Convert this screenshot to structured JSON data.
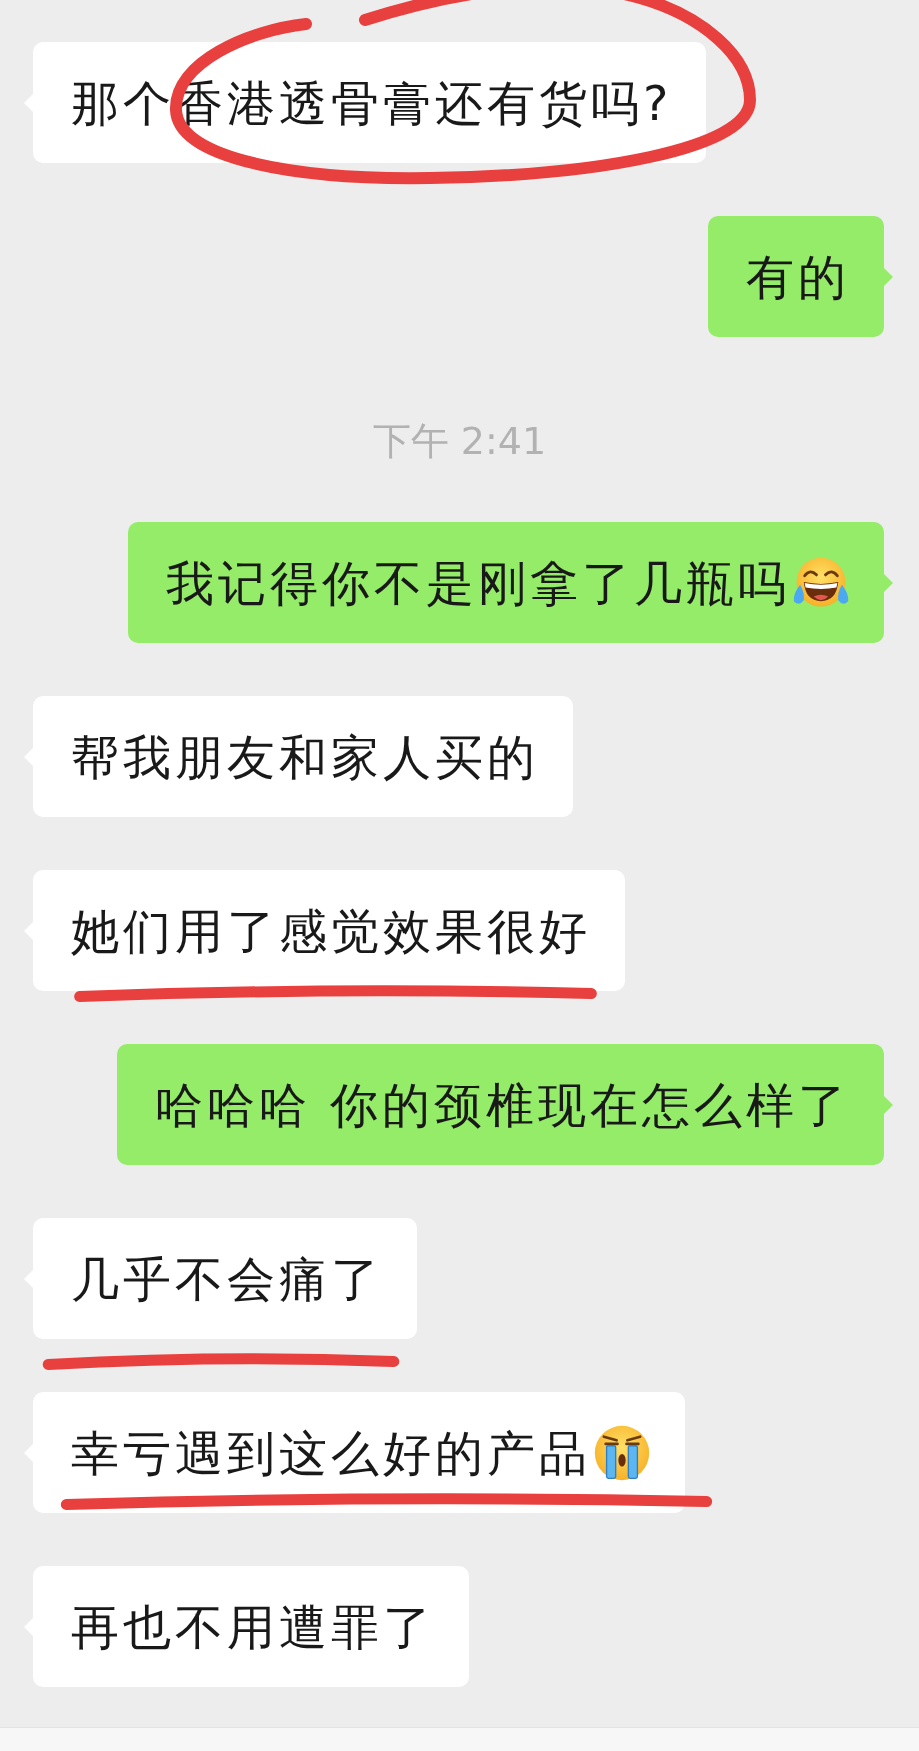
{
  "messages": [
    {
      "kind": "incoming",
      "text": "那个香港透骨膏还有货吗?",
      "circled": true,
      "underlined": false
    },
    {
      "kind": "outgoing",
      "text": "有的",
      "circled": false,
      "underlined": false
    },
    {
      "kind": "time",
      "text": "下午 2:41"
    },
    {
      "kind": "outgoing",
      "text": "我记得你不是刚拿了几瓶吗",
      "emoji": {
        "kind": "tears_of_joy"
      },
      "circled": false,
      "underlined": false
    },
    {
      "kind": "incoming",
      "text": "帮我朋友和家人买的",
      "circled": false,
      "underlined": false
    },
    {
      "kind": "incoming",
      "text": "她们用了感觉效果很好",
      "circled": false,
      "underlined": true
    },
    {
      "kind": "outgoing",
      "text": "哈哈哈 你的颈椎现在怎么样了",
      "circled": false,
      "underlined": false
    },
    {
      "kind": "incoming",
      "text": "几乎不会痛了",
      "circled": false,
      "underlined": true
    },
    {
      "kind": "incoming",
      "text": "幸亏遇到这么好的产品",
      "emoji": {
        "kind": "loudly_crying"
      },
      "circled": false,
      "underlined": true
    },
    {
      "kind": "incoming",
      "text": "再也不用遭罪了",
      "circled": false,
      "underlined": false
    }
  ]
}
